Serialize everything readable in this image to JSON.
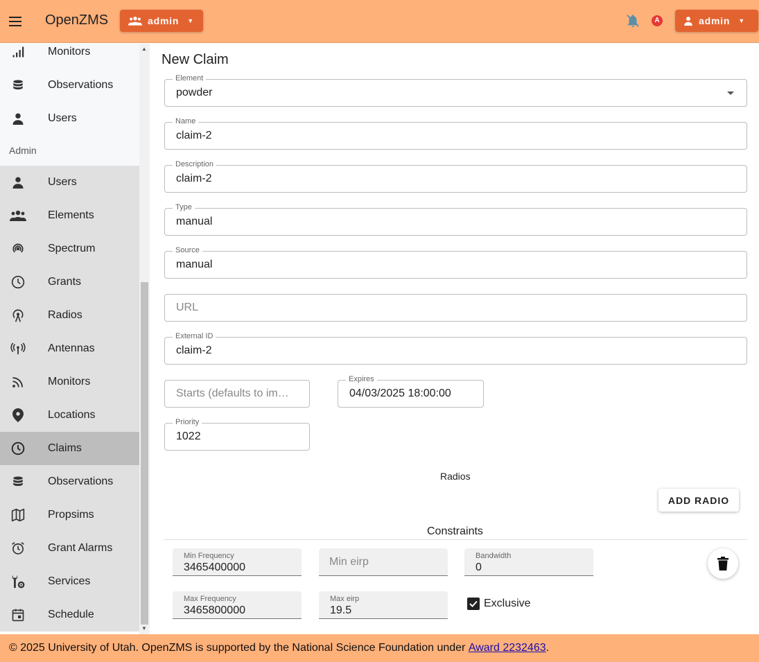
{
  "app": {
    "title": "OpenZMS"
  },
  "header": {
    "element_button": "admin",
    "user_button": "admin",
    "notification_badge": "A"
  },
  "sidebar": {
    "top_items": [
      {
        "label": "Monitors",
        "icon": "signal-bars-icon"
      },
      {
        "label": "Observations",
        "icon": "database-icon"
      },
      {
        "label": "Users",
        "icon": "person-icon"
      }
    ],
    "admin_header": "Admin",
    "admin_items": [
      {
        "label": "Users",
        "icon": "person-icon"
      },
      {
        "label": "Elements",
        "icon": "group-icon"
      },
      {
        "label": "Spectrum",
        "icon": "wifi-tethering-icon"
      },
      {
        "label": "Grants",
        "icon": "clock-icon"
      },
      {
        "label": "Radios",
        "icon": "antenna-icon"
      },
      {
        "label": "Antennas",
        "icon": "broadcast-icon"
      },
      {
        "label": "Monitors",
        "icon": "rss-icon"
      },
      {
        "label": "Locations",
        "icon": "location-pin-icon"
      },
      {
        "label": "Claims",
        "icon": "clock-icon",
        "active": true
      },
      {
        "label": "Observations",
        "icon": "database-icon"
      },
      {
        "label": "Propsims",
        "icon": "map-icon"
      },
      {
        "label": "Grant Alarms",
        "icon": "alarm-icon"
      },
      {
        "label": "Services",
        "icon": "settings-wrench-icon"
      },
      {
        "label": "Schedule",
        "icon": "calendar-icon"
      }
    ]
  },
  "form": {
    "title": "New Claim",
    "element": {
      "label": "Element",
      "value": "powder"
    },
    "name": {
      "label": "Name",
      "value": "claim-2"
    },
    "description": {
      "label": "Description",
      "value": "claim-2"
    },
    "type": {
      "label": "Type",
      "value": "manual"
    },
    "source": {
      "label": "Source",
      "value": "manual"
    },
    "url": {
      "placeholder": "URL"
    },
    "external_id": {
      "label": "External ID",
      "value": "claim-2"
    },
    "starts": {
      "placeholder": "Starts (defaults to im…"
    },
    "expires": {
      "label": "Expires",
      "value": "04/03/2025 18:00:00"
    },
    "priority": {
      "label": "Priority",
      "value": "1022"
    },
    "radios_label": "Radios",
    "add_radio": "ADD RADIO",
    "constraints_title": "Constraints",
    "constraints": {
      "min_frequency": {
        "label": "Min Frequency",
        "value": "3465400000"
      },
      "min_eirp": {
        "placeholder": "Min eirp"
      },
      "bandwidth": {
        "label": "Bandwidth",
        "value": "0"
      },
      "max_frequency": {
        "label": "Max Frequency",
        "value": "3465800000"
      },
      "max_eirp": {
        "label": "Max eirp",
        "value": "19.5"
      },
      "exclusive": {
        "label": "Exclusive",
        "checked": true
      }
    }
  },
  "footer": {
    "text": "© 2025 University of Utah. OpenZMS is supported by the National Science Foundation under ",
    "link": "Award 2232463",
    "suffix": "."
  }
}
